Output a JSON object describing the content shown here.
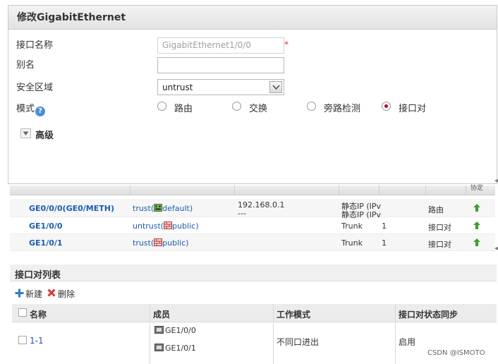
{
  "dialog": {
    "title": "修改GigabitEthernet",
    "fields": {
      "interface_name_label": "接口名称",
      "interface_name_value": "GigabitEthernet1/0/0",
      "required_mark": "*",
      "alias_label": "别名",
      "alias_value": "",
      "zone_label": "安全区域",
      "zone_value": "untrust",
      "mode_label": "模式",
      "help_glyph": "?"
    },
    "mode_options": [
      {
        "label": "路由",
        "checked": false
      },
      {
        "label": "交换",
        "checked": false
      },
      {
        "label": "旁路检测",
        "checked": false
      },
      {
        "label": "接口对",
        "checked": true
      }
    ],
    "advanced_label": "高级"
  },
  "interface_table": {
    "header_cut_text": "协定",
    "rows": [
      {
        "name": "GE0/0/0(GE0/METH)",
        "zone": "trust(",
        "vsys": "default)",
        "ip": "192.168.0.1",
        "ip2": "---",
        "ip_type": "静态IP (IPv",
        "ip_type2": "静态IP (IPv",
        "vlan": "",
        "mode": "路由"
      },
      {
        "name": "GE1/0/0",
        "zone": "untrust(",
        "vsys": "public)",
        "ip": "",
        "ip2": "",
        "ip_type": "Trunk",
        "ip_type2": "",
        "vlan": "1",
        "mode": "接口对"
      },
      {
        "name": "GE1/0/1",
        "zone": "trust(",
        "vsys": "public)",
        "ip": "",
        "ip2": "",
        "ip_type": "Trunk",
        "ip_type2": "",
        "vlan": "1",
        "mode": "接口对"
      }
    ]
  },
  "pair_list": {
    "title": "接口对列表",
    "toolbar": {
      "new_label": "新建",
      "delete_label": "删除"
    },
    "columns": [
      "名称",
      "成员",
      "工作模式",
      "接口对状态同步"
    ],
    "rows": [
      {
        "name": "1-1",
        "members": [
          "GE1/0/0",
          "GE1/0/1"
        ],
        "work_mode": "不同口进出",
        "status_sync": "启用"
      }
    ]
  },
  "watermark": "CSDN @ISMOTO",
  "colors": {
    "link": "#1b5dae",
    "radio_checked": "#b00020",
    "required": "#e03030",
    "status_up": "#3aa030"
  },
  "icons": [
    "help-icon",
    "dropdown-arrow-icon",
    "expand-toggle-icon",
    "zone-icon",
    "status-up-icon",
    "add-icon",
    "delete-icon",
    "port-icon"
  ]
}
